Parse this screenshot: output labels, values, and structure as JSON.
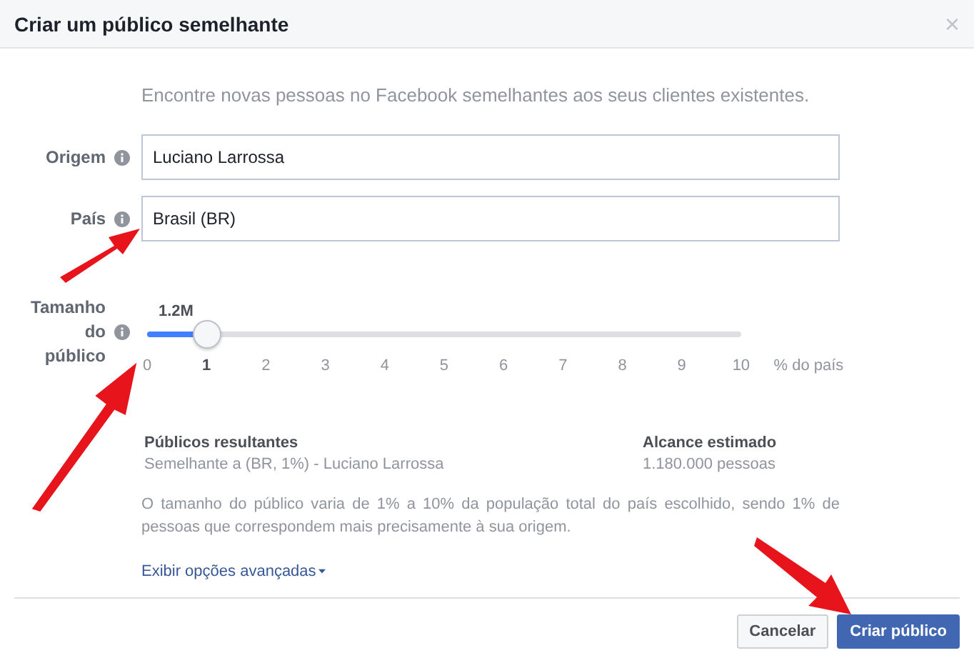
{
  "dialog": {
    "title": "Criar um público semelhante",
    "close": "×"
  },
  "intro": "Encontre novas pessoas no Facebook semelhantes aos seus clientes existentes.",
  "fields": [
    {
      "label": "Origem",
      "value": "Luciano Larrossa"
    },
    {
      "label": "País",
      "value": "Brasil (BR)"
    }
  ],
  "audience_size": {
    "label": "Tamanho do público",
    "reading": "1.2M",
    "level": 0.1,
    "unit": "% do país",
    "ticks": [
      {
        "label": "0",
        "selected": false
      },
      {
        "label": "1",
        "selected": true
      },
      {
        "label": "2",
        "selected": false
      },
      {
        "label": "3",
        "selected": false
      },
      {
        "label": "4",
        "selected": false
      },
      {
        "label": "5",
        "selected": false
      },
      {
        "label": "6",
        "selected": false
      },
      {
        "label": "7",
        "selected": false
      },
      {
        "label": "8",
        "selected": false
      },
      {
        "label": "9",
        "selected": false
      },
      {
        "label": "10",
        "selected": false
      }
    ]
  },
  "results": {
    "audiences_heading": "Públicos resultantes",
    "audience": "Semelhante a (BR, 1%) - Luciano Larrossa",
    "reach_heading": "Alcance estimado",
    "reach": "1.180.000 pessoas"
  },
  "note": "O tamanho do público varia de 1% a 10% da população total do país escolhido, sendo 1% de pessoas que correspondem mais precisamente à sua origem.",
  "advanced_link": "Exibir opções avançadas",
  "buttons": [
    {
      "label": "Cancelar",
      "kind": "secondary"
    },
    {
      "label": "Criar público",
      "kind": "primary"
    }
  ]
}
